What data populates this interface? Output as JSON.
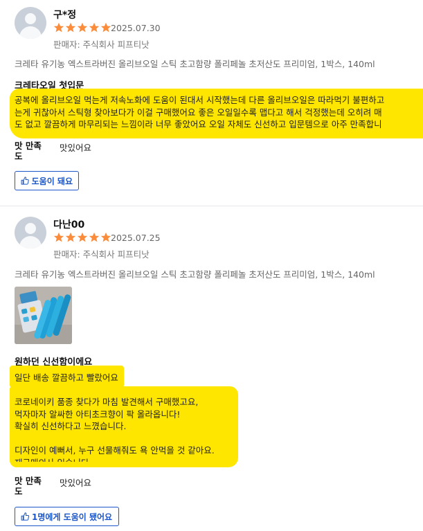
{
  "reviews": [
    {
      "reviewer": "구*정",
      "rating": 5,
      "date": "2025.07.30",
      "seller": "판매자: 주식회사 피프티낫",
      "product": "크레타 유기농 엑스트라버진 올리브오일 스틱 초고함량 폴리페놀 초저산도 프리미엄, 1박스, 140ml",
      "title": "크레타오일 첫입문",
      "body": "공복에 올리브오일 먹는게 저속노화에 도움이 된대서 시작했는데 다른 올리브오일은 따라먹기 불편하고\n는게 귀찮아서 스틱형 찾아보다가 이걸 구매했어요 좋은 오일일수록 맵다고 해서 걱정했는데 오히려 매\n도 없고 깔끔하게 마무리되는 느낌이라 너무 좋았어요 오일 자체도 신선하고 입문템으로 아주 만족합니",
      "taste_label": "맛 만족도",
      "taste_value": "맛있어요",
      "helpful": "도움이 돼요"
    },
    {
      "reviewer": "다난00",
      "rating": 5,
      "date": "2025.07.25",
      "seller": "판매자: 주식회사 피프티낫",
      "product": "크레타 유기농 엑스트라버진 올리브오일 스틱 초고함량 폴리페놀 초저산도 프리미엄, 1박스, 140ml",
      "title": "원하던 신선함이에요",
      "body": "일단 배송 깔끔하고 빨랐어요\n\n코로네이키 품종 찾다가 마침 발견해서 구매했고요,\n먹자마자 알싸한 아티초크향이 팍 올라옵니다!\n확실히 신선하다고 느꼈습니다.\n\n디자인이 예뻐서, 누구 선물해줘도 욕 안먹을 것 같아요.\n재구매의사 있습니다",
      "taste_label": "맛 만족도",
      "taste_value": "맛있어요",
      "helpful": "1명에게 도움이 됐어요"
    }
  ],
  "colors": {
    "star": "#fa8c3c",
    "highlight": "#ffe600",
    "helpful_button": "#1a56c9"
  },
  "icons": [
    "user-avatar-icon",
    "star-icon",
    "thumbs-up-icon"
  ]
}
